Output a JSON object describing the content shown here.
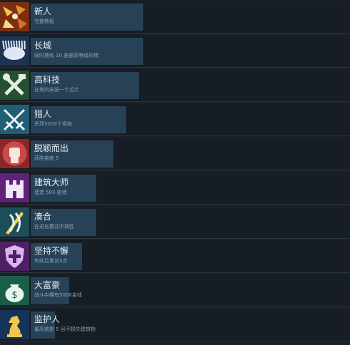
{
  "achievements": [
    {
      "title": "新人",
      "description": "完整教程",
      "icon": "new-survivor-icon",
      "color": "#c8882a",
      "progress": 0.79
    },
    {
      "title": "长城",
      "description": "同时拥有 10 座最高等级的墙",
      "icon": "spiked-wall-icon",
      "color": "#2f5a8c",
      "progress": 0.79
    },
    {
      "title": "高科技",
      "description": "在塔内安装一个芯片",
      "icon": "wrench-hammer-icon",
      "color": "#3c7a4a",
      "progress": 0.76
    },
    {
      "title": "猎人",
      "description": "杀死5000个怪物",
      "icon": "crossed-swords-icon",
      "color": "#2f8fa8",
      "progress": 0.67
    },
    {
      "title": "脱颖而出",
      "description": "获胜难度 5",
      "icon": "raised-fist-icon",
      "color": "#b03a3a",
      "progress": 0.58
    },
    {
      "title": "建筑大师",
      "description": "建造 500 座墙",
      "icon": "castle-icon",
      "color": "#8a3aa8",
      "progress": 0.46
    },
    {
      "title": "凑合",
      "description": "在进化模式中获胜",
      "icon": "sword-claw-icon",
      "color": "#3a7a8a",
      "progress": 0.46
    },
    {
      "title": "坚持不懈",
      "description": "失败后重试3次",
      "icon": "shield-cross-icon",
      "color": "#7a3a9a",
      "progress": 0.36
    },
    {
      "title": "大富豪",
      "description": "战斗中拥有5000金钱",
      "icon": "money-bag-icon",
      "color": "#2a8a6a",
      "progress": 0.27
    },
    {
      "title": "监护人",
      "description": "最高难度 5 且不损失建筑物",
      "icon": "chess-knight-icon",
      "color": "#1f4a7a",
      "progress": 0.17
    }
  ]
}
